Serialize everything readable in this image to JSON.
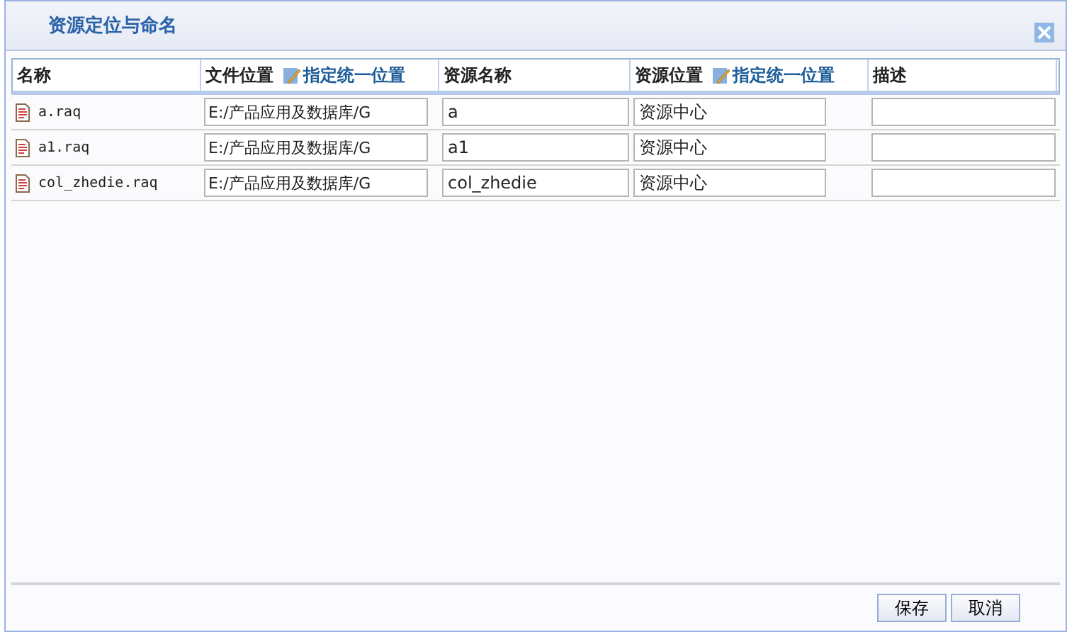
{
  "dialog": {
    "title": "资源定位与命名"
  },
  "table": {
    "columns": [
      {
        "label": "名称"
      },
      {
        "label": "文件位置",
        "action": "指定统一位置"
      },
      {
        "label": "资源名称"
      },
      {
        "label": "资源位置",
        "action": "指定统一位置"
      },
      {
        "label": "描述"
      }
    ],
    "rows": [
      {
        "name": "a.raq",
        "file_location": "E:/产品应用及数据库/G",
        "resource_name": "a",
        "resource_location": "资源中心"
      },
      {
        "name": "a1.raq",
        "file_location": "E:/产品应用及数据库/G",
        "resource_name": "a1",
        "resource_location": "资源中心"
      },
      {
        "name": "col_zhedie.raq",
        "file_location": "E:/产品应用及数据库/G",
        "resource_name": "col_zhedie",
        "resource_location": "资源中心"
      }
    ]
  },
  "buttons": [
    "保存",
    "取消"
  ]
}
